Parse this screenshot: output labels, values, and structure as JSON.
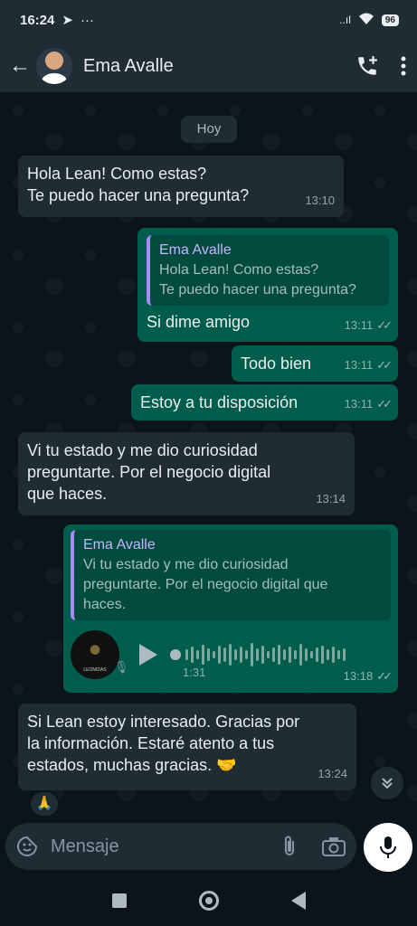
{
  "status": {
    "time": "16:24",
    "signal": "..ıl",
    "battery": "96"
  },
  "header": {
    "contact_name": "Ema Avalle"
  },
  "chat": {
    "day_label": "Hoy",
    "messages": [
      {
        "line1": "Hola Lean! Como estas?",
        "line2": "Te puedo hacer una pregunta?",
        "time": "13:10"
      },
      {
        "quote_name": "Ema Avalle",
        "quote_line1": "Hola Lean! Como estas?",
        "quote_line2": "Te puedo hacer una pregunta?",
        "text": "Si dime amigo",
        "time": "13:11",
        "ticks": "✓✓"
      },
      {
        "text": "Todo bien",
        "time": "13:11",
        "ticks": "✓✓"
      },
      {
        "text": "Estoy a tu disposición",
        "time": "13:11",
        "ticks": "✓✓"
      },
      {
        "line1": "Vi tu estado y me dio curiosidad",
        "line2": "preguntarte. Por el negocio digital",
        "line3": "que haces.",
        "time": "13:14"
      },
      {
        "quote_name": "Ema Avalle",
        "quote_line1": "Vi tu estado y me dio curiosidad",
        "quote_line2": "preguntarte. Por el negocio digital que",
        "quote_line3": "haces.",
        "voice_duration": "1:31",
        "voice_avatar_text": "LEONIDAS",
        "time": "13:18",
        "ticks": "✓✓"
      },
      {
        "line1": "Si Lean estoy interesado. Gracias por",
        "line2": "la información. Estaré atento a tus",
        "line3": "estados, muchas gracias. 🤝",
        "time": "13:24",
        "reaction": "🙏"
      }
    ]
  },
  "composer": {
    "placeholder": "Mensaje"
  }
}
